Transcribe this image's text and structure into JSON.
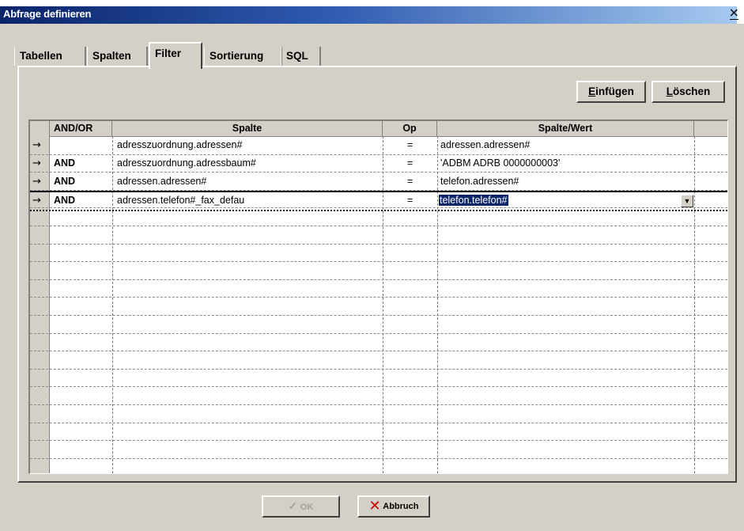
{
  "window": {
    "title": "Abfrage definieren",
    "close_label": "×"
  },
  "tabs": [
    {
      "label": "Tabellen",
      "active": false
    },
    {
      "label": "Spalten",
      "active": false
    },
    {
      "label": "Filter",
      "active": true
    },
    {
      "label": "Sortierung",
      "active": false
    },
    {
      "label": "SQL",
      "active": false
    }
  ],
  "actions": {
    "insert_label_prefix": "E",
    "insert_label_rest": "infügen",
    "delete_label_prefix": "L",
    "delete_label_rest": "öschen"
  },
  "grid": {
    "columns": [
      "AND/OR",
      "Spalte",
      "Op",
      "Spalte/Wert"
    ],
    "rows": [
      {
        "andor": "",
        "spalte": "adresszuordnung.adressen#",
        "op": "=",
        "wert": "adressen.adressen#"
      },
      {
        "andor": "AND",
        "spalte": "adresszuordnung.adressbaum#",
        "op": "=",
        "wert": "'ADBM ADRB 0000000003'"
      },
      {
        "andor": "AND",
        "spalte": "adressen.adressen#",
        "op": "=",
        "wert": "telefon.adressen#"
      },
      {
        "andor": "AND",
        "spalte": "adressen.telefon#_fax_defau",
        "op": "=",
        "wert": "telefon.telefon#"
      }
    ],
    "row_indicator": "→",
    "selected_row": 3,
    "dropdown_icon": "chevron-down-icon"
  },
  "footer": {
    "ok_label": "OK",
    "cancel_label": "Abbruch"
  },
  "colors": {
    "titlebar": "#0a246a",
    "face": "#d4d0c8",
    "cancel_icon": "#d40000"
  }
}
